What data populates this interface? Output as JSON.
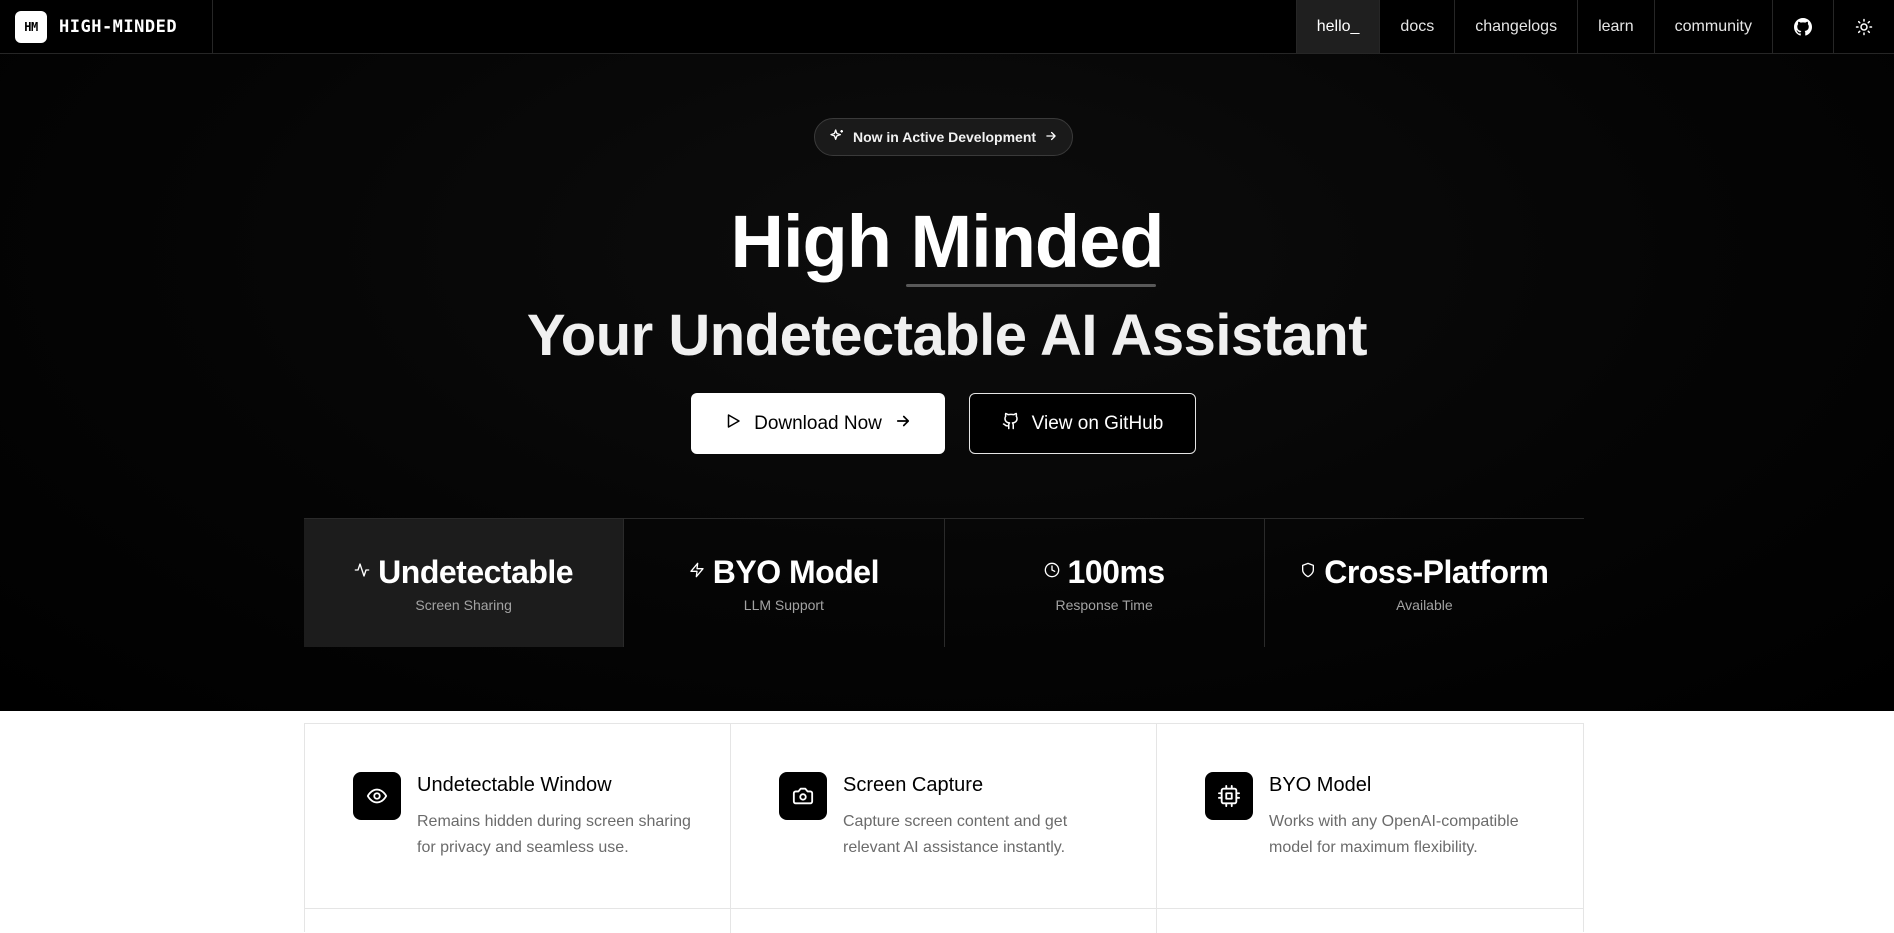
{
  "nav": {
    "logo_text": "HM",
    "brand": "HIGH-MINDED",
    "links": [
      {
        "label": "hello_"
      },
      {
        "label": "docs"
      },
      {
        "label": "changelogs"
      },
      {
        "label": "learn"
      },
      {
        "label": "community"
      }
    ],
    "icons": [
      "github-icon",
      "sun-icon"
    ]
  },
  "hero": {
    "badge": "Now in Active Development",
    "title_line1": "High Minded",
    "title_line2": "Your Undetectable AI Assistant",
    "primary_button": "Download Now",
    "secondary_button": "View on GitHub"
  },
  "stats": [
    {
      "icon": "activity-icon",
      "value": "Undetectable",
      "label": "Screen Sharing"
    },
    {
      "icon": "zap-icon",
      "value": "BYO Model",
      "label": "LLM Support"
    },
    {
      "icon": "clock-icon",
      "value": "100ms",
      "label": "Response Time"
    },
    {
      "icon": "shield-icon",
      "value": "Cross-Platform",
      "label": "Available"
    }
  ],
  "features": [
    {
      "icon": "eye-icon",
      "title": "Undetectable Window",
      "description": "Remains hidden during screen sharing for privacy and seamless use."
    },
    {
      "icon": "camera-icon",
      "title": "Screen Capture",
      "description": "Capture screen content and get relevant AI assistance instantly."
    },
    {
      "icon": "cpu-icon",
      "title": "BYO Model",
      "description": "Works with any OpenAI-compatible model for maximum flexibility."
    }
  ],
  "colors": {
    "hero_bg": "#000000",
    "accent": "#ffffff",
    "muted_text": "#a3a3a3"
  }
}
